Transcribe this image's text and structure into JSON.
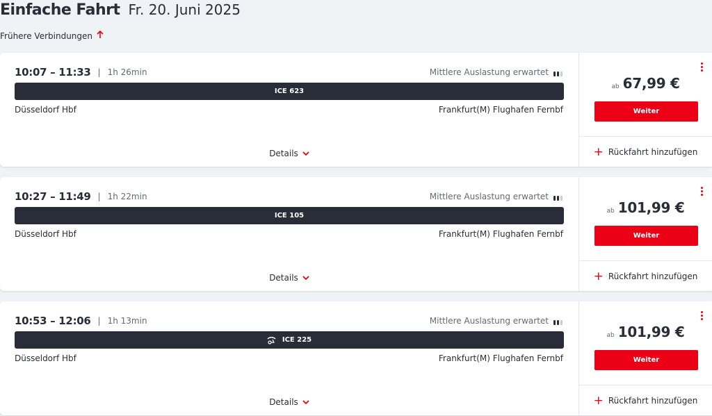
{
  "header": {
    "title": "Einfache Fahrt",
    "date": "Fr. 20. Juni 2025"
  },
  "earlier_connections": {
    "label": "Frühere Verbindungen",
    "icon": "arrow-up-icon"
  },
  "connections": [
    {
      "time_range": "10:07 – 11:33",
      "duration": "1h 26min",
      "occupancy": "Mittlere Auslastung erwartet",
      "train": "ICE 623",
      "has_bike_icon": false,
      "from": "Düsseldorf Hbf",
      "to": "Frankfurt(M) Flughafen Fernbf",
      "details_label": "Details",
      "price_prefix": "ab",
      "price": "67,99 €",
      "button_label": "Weiter",
      "return_label": "Rückfahrt hinzufügen"
    },
    {
      "time_range": "10:27 – 11:49",
      "duration": "1h 22min",
      "occupancy": "Mittlere Auslastung erwartet",
      "train": "ICE 105",
      "has_bike_icon": false,
      "from": "Düsseldorf Hbf",
      "to": "Frankfurt(M) Flughafen Fernbf",
      "details_label": "Details",
      "price_prefix": "ab",
      "price": "101,99 €",
      "button_label": "Weiter",
      "return_label": "Rückfahrt hinzufügen"
    },
    {
      "time_range": "10:53 – 12:06",
      "duration": "1h 13min",
      "occupancy": "Mittlere Auslastung erwartet",
      "train": "ICE 225",
      "has_bike_icon": true,
      "from": "Düsseldorf Hbf",
      "to": "Frankfurt(M) Flughafen Fernbf",
      "details_label": "Details",
      "price_prefix": "ab",
      "price": "101,99 €",
      "button_label": "Weiter",
      "return_label": "Rückfahrt hinzufügen"
    }
  ],
  "colors": {
    "accent": "#ec0016",
    "train_bar": "#282d37",
    "background": "#f0f3f5"
  }
}
